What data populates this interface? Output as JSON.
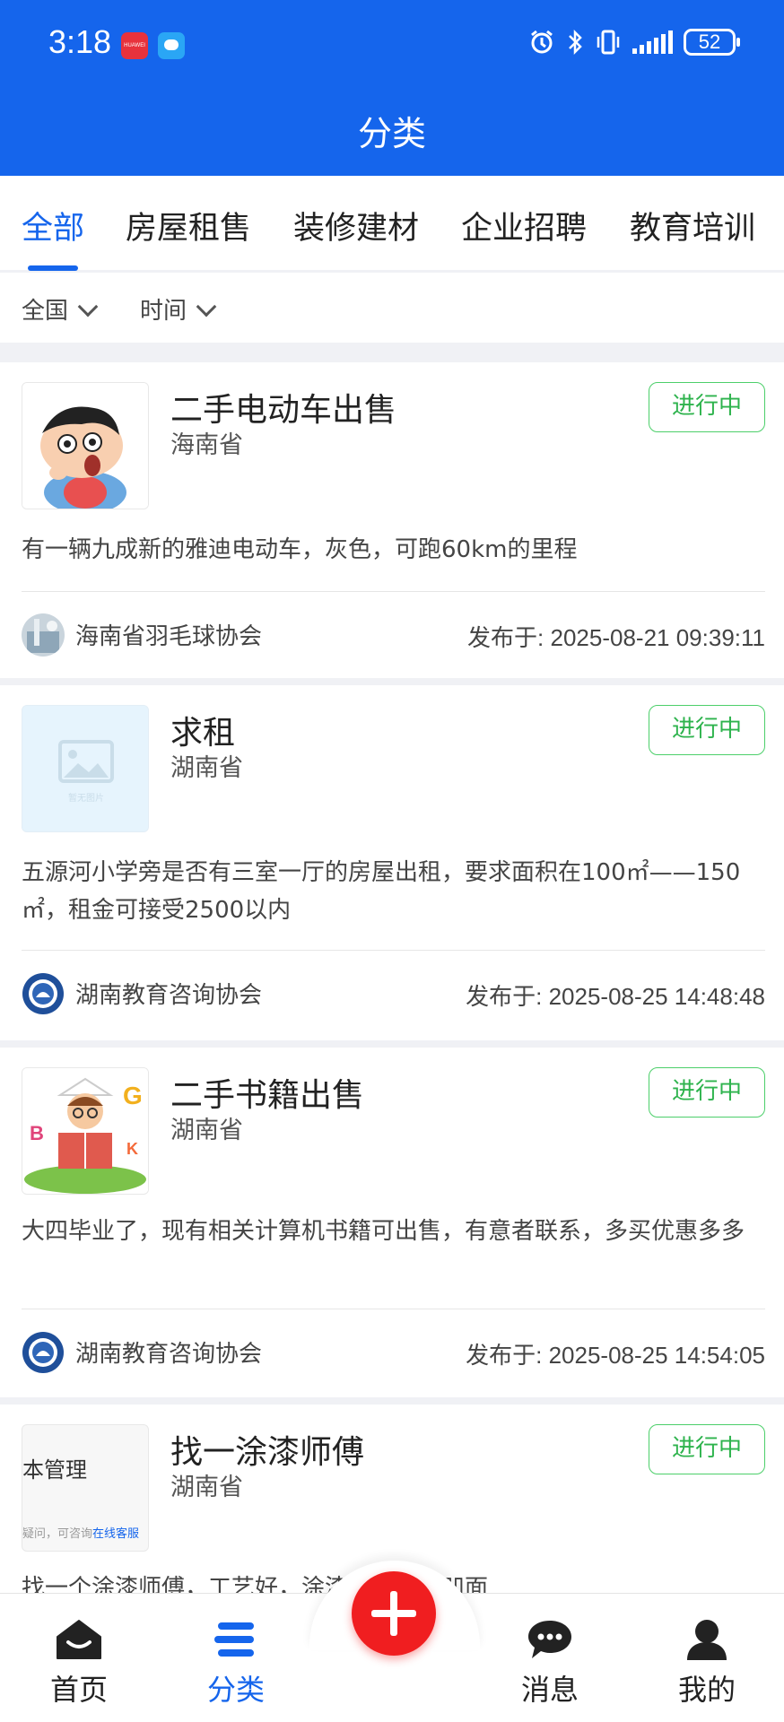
{
  "status_bar": {
    "time": "3:18",
    "huawei_badge": "HUAWEI",
    "battery": "52"
  },
  "header": {
    "title": "分类"
  },
  "tabs": [
    {
      "label": "全部",
      "active": true
    },
    {
      "label": "房屋租售",
      "active": false
    },
    {
      "label": "装修建材",
      "active": false
    },
    {
      "label": "企业招聘",
      "active": false
    },
    {
      "label": "教育培训",
      "active": false
    }
  ],
  "filters": {
    "region": "全国",
    "time": "时间"
  },
  "listings": [
    {
      "title": "二手电动车出售",
      "region": "海南省",
      "status": "进行中",
      "description": "有一辆九成新的雅迪电动车，灰色，可跑60km的里程",
      "author": "海南省羽毛球协会",
      "published": "发布于: 2025-08-21 09:39:11",
      "thumb_icon": "cartoon-boy-image"
    },
    {
      "title": "求租",
      "region": "湖南省",
      "status": "进行中",
      "description": "五源河小学旁是否有三室一厅的房屋出租，要求面积在100㎡——150㎡，租金可接受2500以内",
      "author": "湖南教育咨询协会",
      "published": "发布于: 2025-08-25 14:48:48",
      "thumb_icon": "placeholder-image",
      "thumb_caption": "暂无图片"
    },
    {
      "title": "二手书籍出售",
      "region": "湖南省",
      "status": "进行中",
      "description": "大四毕业了，现有相关计算机书籍可出售，有意者联系，多买优惠多多",
      "author": "湖南教育咨询协会",
      "published": "发布于: 2025-08-25 14:54:05",
      "thumb_icon": "reading-child-image"
    },
    {
      "title": "找一涂漆师傅",
      "region": "湖南省",
      "status": "进行中",
      "description": "找一个涂漆师傅，工艺好，涂漆平整，无凹面",
      "thumb_icon": "screenshot-image",
      "thumb_text": "本管理",
      "thumb_sub": "疑问，可咨询",
      "thumb_link": "在线客服"
    }
  ],
  "bottom_nav": [
    {
      "label": "首页",
      "icon": "home-icon",
      "active": false
    },
    {
      "label": "分类",
      "icon": "category-icon",
      "active": true
    },
    {
      "label": "消息",
      "icon": "message-icon",
      "active": false
    },
    {
      "label": "我的",
      "icon": "profile-icon",
      "active": false
    }
  ],
  "colors": {
    "primary": "#1565ec",
    "status_green": "#2eb34d",
    "fab_red": "#f01e20"
  }
}
